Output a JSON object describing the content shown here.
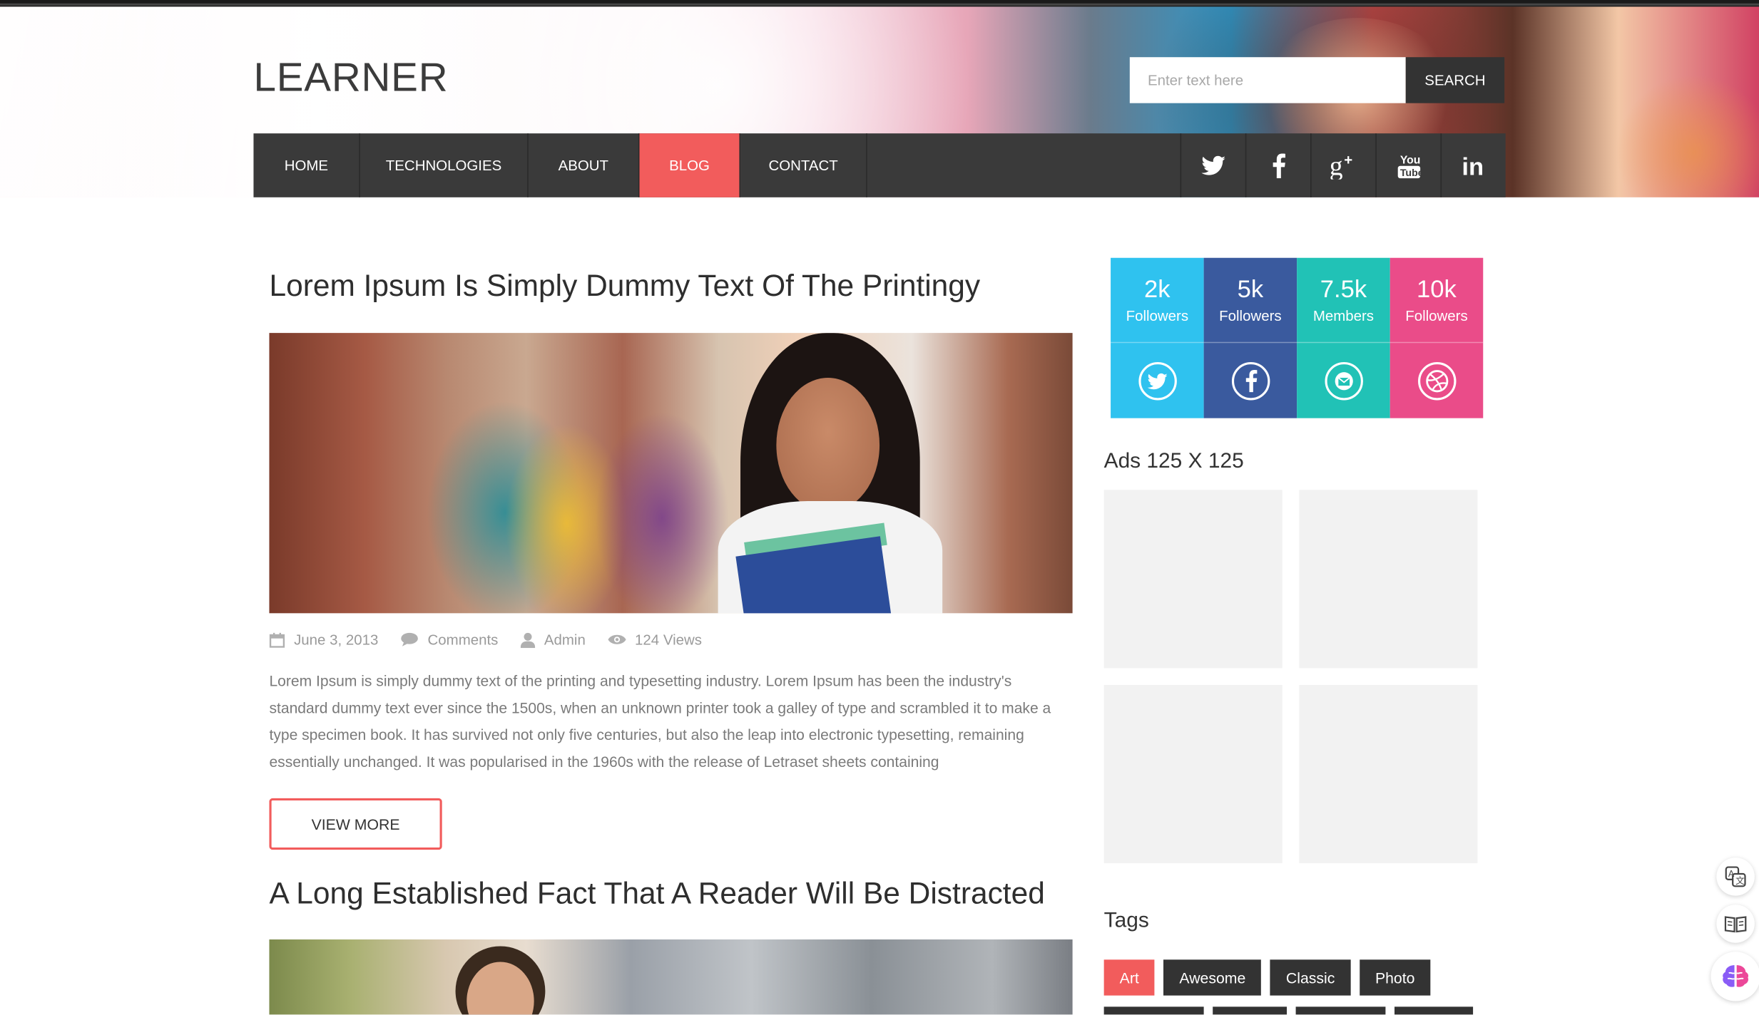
{
  "brand": {
    "logo": "LEARNER"
  },
  "search": {
    "placeholder": "Enter text here",
    "button_label": "SEARCH"
  },
  "nav": {
    "items": [
      {
        "label": "HOME",
        "active": false
      },
      {
        "label": "TECHNOLOGIES",
        "active": false
      },
      {
        "label": "ABOUT",
        "active": false
      },
      {
        "label": "BLOG",
        "active": true
      },
      {
        "label": "CONTACT",
        "active": false
      }
    ],
    "social": [
      "twitter-icon",
      "facebook-icon",
      "google-plus-icon",
      "youtube-icon",
      "linkedin-icon"
    ]
  },
  "posts": [
    {
      "title": "Lorem Ipsum Is Simply Dummy Text Of The Printingy",
      "meta": {
        "date": "June 3, 2013",
        "comments": "Comments",
        "author": "Admin",
        "views": "124 Views"
      },
      "excerpt": "Lorem Ipsum is simply dummy text of the printing and typesetting industry. Lorem Ipsum has been the industry's standard dummy text ever since the 1500s, when an unknown printer took a galley of type and scrambled it to make a type specimen book. It has survived not only five centuries, but also the leap into electronic typesetting, remaining essentially unchanged. It was popularised in the 1960s with the release of Letraset sheets containing",
      "button": "VIEW MORE"
    },
    {
      "title": "A Long Established Fact That A Reader Will Be Distracted"
    }
  ],
  "sidebar": {
    "stats": [
      {
        "value": "2k",
        "label": "Followers",
        "icon": "twitter-icon",
        "color": "#2fc2ef"
      },
      {
        "value": "5k",
        "label": "Followers",
        "icon": "facebook-icon",
        "color": "#3a5a9e"
      },
      {
        "value": "7.5k",
        "label": "Members",
        "icon": "mail-icon",
        "color": "#21c2b6"
      },
      {
        "value": "10k",
        "label": "Followers",
        "icon": "dribbble-icon",
        "color": "#ea4c89"
      }
    ],
    "ads_heading": "Ads 125 X 125",
    "tags_heading": "Tags",
    "tags": [
      {
        "label": "Art",
        "active": true
      },
      {
        "label": "Awesome",
        "active": false
      },
      {
        "label": "Classic",
        "active": false
      },
      {
        "label": "Photo",
        "active": false
      }
    ]
  },
  "colors": {
    "accent": "#f25c5c",
    "nav_bg": "#3a3a3a",
    "dark": "#333333"
  }
}
